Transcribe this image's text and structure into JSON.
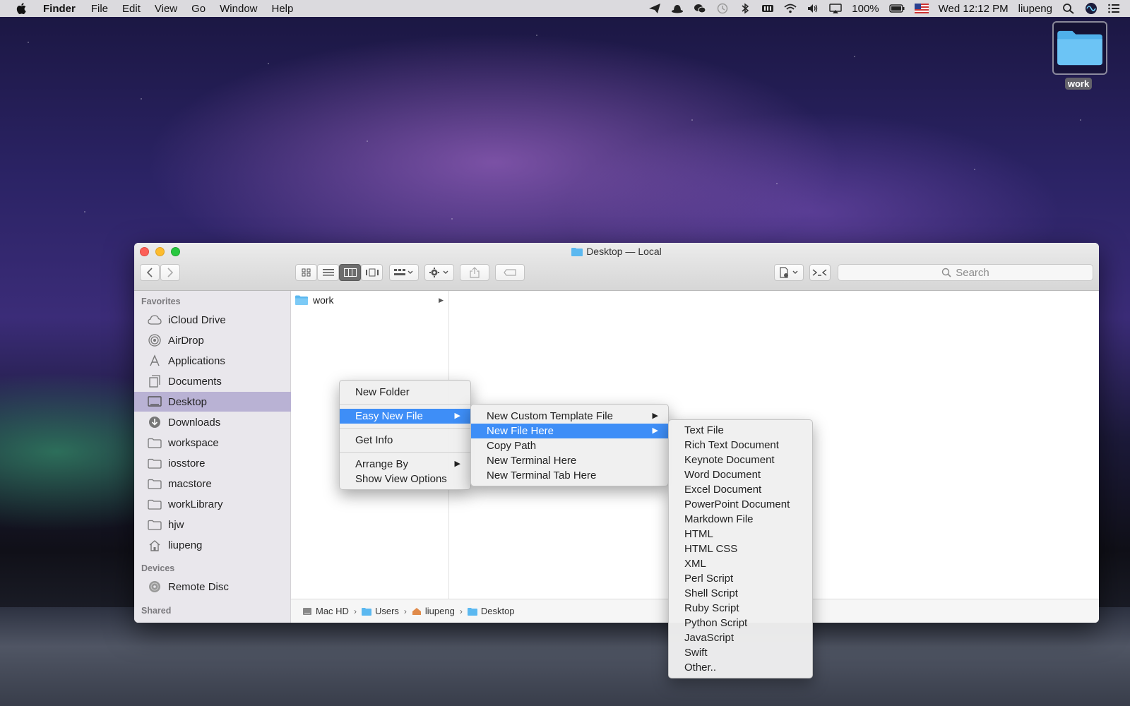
{
  "menubar": {
    "app_name": "Finder",
    "items": [
      "File",
      "Edit",
      "View",
      "Go",
      "Window",
      "Help"
    ],
    "status": {
      "battery": "100%",
      "clock": "Wed 12:12 PM",
      "user": "liupeng"
    }
  },
  "desktop_icon": {
    "label": "work"
  },
  "window": {
    "title": "Desktop — Local",
    "search_placeholder": "Search",
    "sidebar": {
      "favorites_heading": "Favorites",
      "favorites": [
        "iCloud Drive",
        "AirDrop",
        "Applications",
        "Documents",
        "Desktop",
        "Downloads",
        "workspace",
        "iosstore",
        "macstore",
        "workLibrary",
        "hjw",
        "liupeng"
      ],
      "devices_heading": "Devices",
      "devices": [
        "Remote Disc"
      ],
      "shared_heading": "Shared"
    },
    "column": {
      "item": "work"
    },
    "pathbar": [
      "Mac HD",
      "Users",
      "liupeng",
      "Desktop"
    ]
  },
  "context_menu": {
    "items": [
      "New Folder",
      "Easy New File",
      "Get Info",
      "Arrange By",
      "Show View Options"
    ]
  },
  "easy_menu": {
    "items": [
      "New Custom Template File",
      "New File Here",
      "Copy Path",
      "New Terminal Here",
      "New Terminal Tab Here"
    ]
  },
  "file_menu": {
    "items": [
      "Text File",
      "Rich Text Document",
      "Keynote Document",
      "Word Document",
      "Excel Document",
      "PowerPoint Document",
      "Markdown File",
      "HTML",
      "HTML CSS",
      "XML",
      "Perl Script",
      "Shell Script",
      "Ruby Script",
      "Python Script",
      "JavaScript",
      "Swift",
      "Other.."
    ]
  },
  "colors": {
    "highlight": "#3e8ef7",
    "sidebar_selection": "#b9b2d4",
    "folder_blue": "#5bb8f0"
  }
}
